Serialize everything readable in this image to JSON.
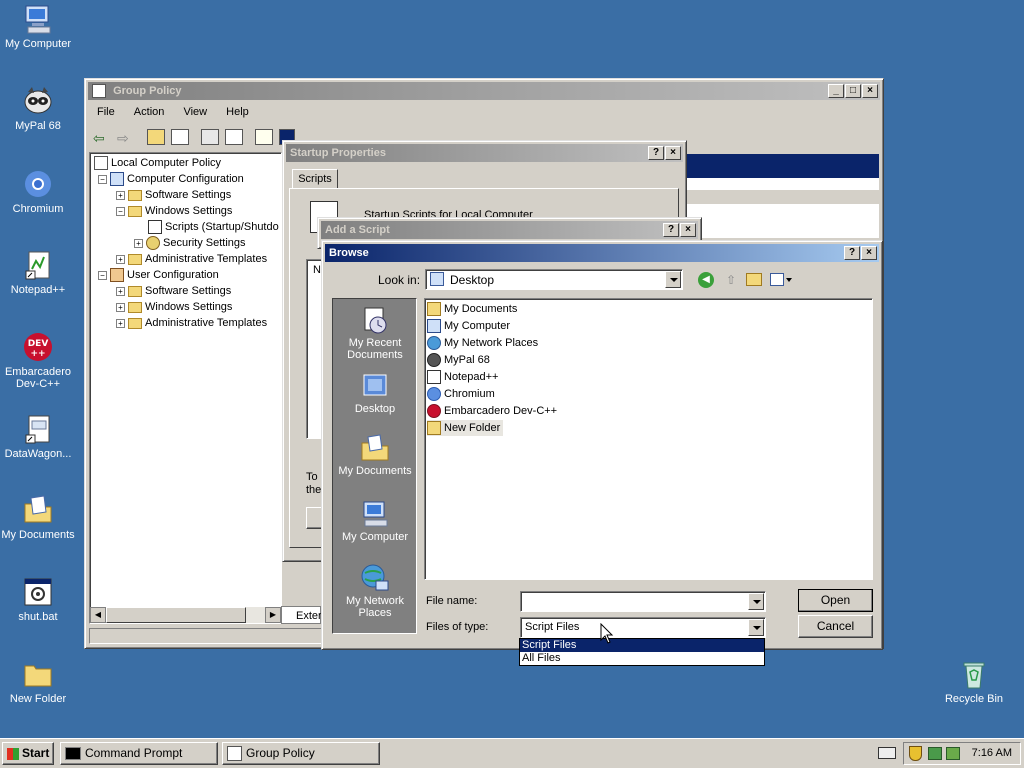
{
  "desktop": {
    "icons": [
      {
        "label": "My Computer",
        "icon": "computer-icon"
      },
      {
        "label": "MyPal 68",
        "icon": "raccoon-icon"
      },
      {
        "label": "Chromium",
        "icon": "chromium-icon"
      },
      {
        "label": "Notepad++",
        "icon": "notepad-icon"
      },
      {
        "label": "Embarcadero Dev-C++",
        "icon": "devcpp-icon"
      },
      {
        "label": "DataWagon...",
        "icon": "document-icon"
      },
      {
        "label": "My Documents",
        "icon": "documents-folder-icon"
      },
      {
        "label": "shut.bat",
        "icon": "batch-file-icon"
      },
      {
        "label": "New Folder",
        "icon": "folder-icon"
      }
    ],
    "recycle_bin": "Recycle Bin"
  },
  "group_policy": {
    "title": "Group Policy",
    "menu": [
      "File",
      "Action",
      "View",
      "Help"
    ],
    "tree": [
      {
        "label": "Local Computer Policy",
        "level": 0,
        "expander": ""
      },
      {
        "label": "Computer Configuration",
        "level": 1,
        "expander": "−"
      },
      {
        "label": "Software Settings",
        "level": 2,
        "expander": "+"
      },
      {
        "label": "Windows Settings",
        "level": 2,
        "expander": "−"
      },
      {
        "label": "Scripts (Startup/Shutdo",
        "level": 3,
        "expander": ""
      },
      {
        "label": "Security Settings",
        "level": 3,
        "expander": "+"
      },
      {
        "label": "Administrative Templates",
        "level": 2,
        "expander": "+"
      },
      {
        "label": "User Configuration",
        "level": 1,
        "expander": "−"
      },
      {
        "label": "Software Settings",
        "level": 2,
        "expander": "+"
      },
      {
        "label": "Windows Settings",
        "level": 2,
        "expander": "+"
      },
      {
        "label": "Administrative Templates",
        "level": 2,
        "expander": "+"
      }
    ],
    "tab_extended": "Exter"
  },
  "startup_properties": {
    "title": "Startup Properties",
    "tab": "Scripts",
    "heading": "Startup Scripts for Local Computer",
    "partial_text": [
      "To",
      "the"
    ],
    "col_header": "N"
  },
  "add_script": {
    "title": "Add a Script"
  },
  "browse": {
    "title": "Browse",
    "look_in_label": "Look in:",
    "look_in_value": "Desktop",
    "places": [
      "My Recent Documents",
      "Desktop",
      "My Documents",
      "My Computer",
      "My Network Places"
    ],
    "files": [
      {
        "name": "My Documents",
        "icon": "documents-folder-icon"
      },
      {
        "name": "My Computer",
        "icon": "computer-icon"
      },
      {
        "name": "My Network Places",
        "icon": "network-icon"
      },
      {
        "name": "MyPal 68",
        "icon": "raccoon-icon"
      },
      {
        "name": "Notepad++",
        "icon": "notepad-icon"
      },
      {
        "name": "Chromium",
        "icon": "chromium-icon"
      },
      {
        "name": "Embarcadero Dev-C++",
        "icon": "devcpp-icon"
      },
      {
        "name": "New Folder",
        "icon": "folder-icon"
      }
    ],
    "file_name_label": "File name:",
    "file_name_value": "",
    "files_of_type_label": "Files of type:",
    "files_of_type_value": "Script Files",
    "type_options": [
      "Script Files",
      "All Files"
    ],
    "open_label": "Open",
    "cancel_label": "Cancel"
  },
  "taskbar": {
    "start": "Start",
    "tasks": [
      "Command Prompt",
      "Group Policy"
    ],
    "time": "7:16 AM"
  },
  "colors": {
    "desktop": "#3a6ea5",
    "title_active": "#0a246a",
    "selection": "#0a246a"
  }
}
